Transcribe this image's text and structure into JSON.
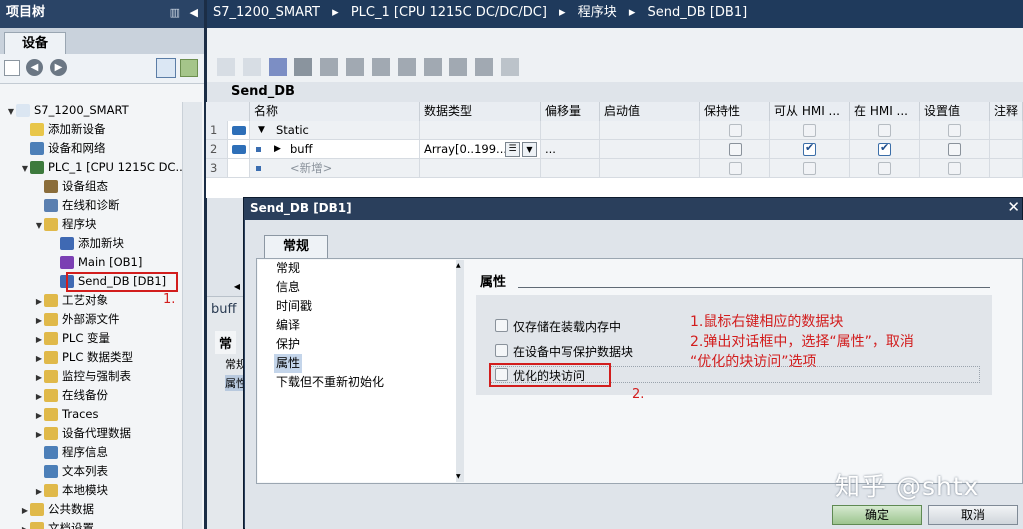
{
  "project_tree": {
    "title": "项目树",
    "devices_tab": "设备",
    "items": [
      {
        "label": "S7_1200_SMART",
        "indent": 0,
        "exp": "▼",
        "color": "#dbe6f2"
      },
      {
        "label": "添加新设备",
        "indent": 1,
        "exp": "",
        "color": "#e8c64a"
      },
      {
        "label": "设备和网络",
        "indent": 1,
        "exp": "",
        "color": "#4c7fb8"
      },
      {
        "label": "PLC_1 [CPU 1215C DC...",
        "indent": 1,
        "exp": "▼",
        "color": "#3d7a3d"
      },
      {
        "label": "设备组态",
        "indent": 2,
        "exp": "",
        "color": "#8a6d3b"
      },
      {
        "label": "在线和诊断",
        "indent": 2,
        "exp": "",
        "color": "#5a7fb0"
      },
      {
        "label": "程序块",
        "indent": 2,
        "exp": "▼",
        "color": "#e0b94a"
      },
      {
        "label": "添加新块",
        "indent": 3,
        "exp": "",
        "color": "#3f69b3"
      },
      {
        "label": "Main [OB1]",
        "indent": 3,
        "exp": "",
        "color": "#7b3fb3"
      },
      {
        "label": "Send_DB [DB1]",
        "indent": 3,
        "exp": "",
        "color": "#3f69b3"
      },
      {
        "label": "工艺对象",
        "indent": 2,
        "exp": "▶",
        "color": "#e0b94a"
      },
      {
        "label": "外部源文件",
        "indent": 2,
        "exp": "▶",
        "color": "#e0b94a"
      },
      {
        "label": "PLC 变量",
        "indent": 2,
        "exp": "▶",
        "color": "#e0b94a"
      },
      {
        "label": "PLC 数据类型",
        "indent": 2,
        "exp": "▶",
        "color": "#e0b94a"
      },
      {
        "label": "监控与强制表",
        "indent": 2,
        "exp": "▶",
        "color": "#e0b94a"
      },
      {
        "label": "在线备份",
        "indent": 2,
        "exp": "▶",
        "color": "#e0b94a"
      },
      {
        "label": "Traces",
        "indent": 2,
        "exp": "▶",
        "color": "#e0b94a"
      },
      {
        "label": "设备代理数据",
        "indent": 2,
        "exp": "▶",
        "color": "#e0b94a"
      },
      {
        "label": "程序信息",
        "indent": 2,
        "exp": "",
        "color": "#4c7fb8"
      },
      {
        "label": "文本列表",
        "indent": 2,
        "exp": "",
        "color": "#4c7fb8"
      },
      {
        "label": "本地模块",
        "indent": 2,
        "exp": "▶",
        "color": "#e0b94a"
      },
      {
        "label": "公共数据",
        "indent": 1,
        "exp": "▶",
        "color": "#e0b94a"
      },
      {
        "label": "文档设置",
        "indent": 1,
        "exp": "▶",
        "color": "#e0b94a"
      }
    ]
  },
  "breadcrumb": {
    "parts": [
      "S7_1200_SMART",
      "PLC_1 [CPU 1215C DC/DC/DC]",
      "程序块",
      "Send_DB [DB1]"
    ]
  },
  "db_editor": {
    "block_name": "Send_DB",
    "columns": [
      "名称",
      "数据类型",
      "偏移量",
      "启动值",
      "保持性",
      "可从 HMI ...",
      "在 HMI ...",
      "设置值",
      "注释"
    ],
    "rows": [
      {
        "num": "1",
        "name": "Static",
        "type": "",
        "offset": ""
      },
      {
        "num": "2",
        "name": "buff",
        "type": "Array[0..199...",
        "offset": "..."
      },
      {
        "num": "3",
        "name": "<新增>",
        "type": "",
        "offset": ""
      }
    ]
  },
  "lower_panel": {
    "tab": "buff",
    "subtab": "常",
    "items": [
      "常规",
      "属性"
    ]
  },
  "dialog": {
    "title": "Send_DB [DB1]",
    "tab": "常规",
    "nav": [
      "常规",
      "信息",
      "时间戳",
      "编译",
      "保护",
      "属性",
      "下载但不重新初始化"
    ],
    "section_title": "属性",
    "options": [
      {
        "label": "仅存储在装载内存中",
        "checked": false
      },
      {
        "label": "在设备中写保护数据块",
        "checked": false
      },
      {
        "label": "优化的块访问",
        "checked": false
      }
    ],
    "ok_label": "确定",
    "cancel_label": "取消"
  },
  "annotations": {
    "marker1": "1.",
    "marker2": "2.",
    "note_line1": "1.鼠标右键相应的数据块",
    "note_line2": "2.弹出对话框中，选择“属性”，取消",
    "note_line3": "“优化的块访问”选项",
    "watermark": "知乎 @shtx"
  }
}
